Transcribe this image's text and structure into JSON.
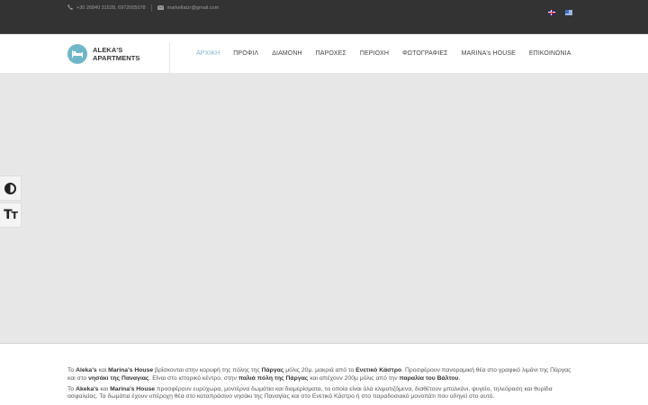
{
  "topbar": {
    "phone_icon": "phone-icon",
    "phone": "+30 26840 31528, 6972005078",
    "email_icon": "envelope-icon",
    "email": "markellatzr@gmail.com",
    "languages": [
      {
        "code": "en",
        "icon": "uk-flag-icon"
      },
      {
        "code": "el",
        "icon": "greek-flag-icon"
      }
    ]
  },
  "logo": {
    "line1": "ALEKA'S",
    "line2": "APARTMENTS",
    "icon": "bed-icon",
    "color": "#6fb6c8"
  },
  "nav": {
    "items": [
      {
        "label": "ΑΡΧΙΚΗ",
        "active": true
      },
      {
        "label": "ΠΡΟΦΙΛ"
      },
      {
        "label": "ΔΙΑΜΟΝΗ"
      },
      {
        "label": "ΠΑΡΟΧΕΣ"
      },
      {
        "label": "ΠΕΡΙΟΧΗ"
      },
      {
        "label": "ΦΩΤΟΓΡΑΦΙΕΣ"
      },
      {
        "label": "MARINA's HOUSE"
      },
      {
        "label": "ΕΠΙΚΟΙΝΩΝΙΑ"
      }
    ],
    "active_color": "#7fb6cf"
  },
  "accessibility": {
    "contrast_icon": "contrast-toggle-icon",
    "fontsize_icon": "font-size-icon"
  },
  "content": {
    "p1": {
      "t1": "Το ",
      "b1": "Aleka's",
      "t2": " και ",
      "b2": "Marina's House",
      "t3": " βρίσκονται στην κορυφή της πόλης της ",
      "b3": "Πάργας",
      "t4": " μόλις 20μ. μακριά από το ",
      "b4": "Ενετικό Κάστρο",
      "t5": ". Προσφέρουν πανοραμική θέα στο γραφικό λιμάνι της Πάργας και στο ",
      "b5": "νησάκι της Παναγιας",
      "t6": ". Είναι στο ιστορικό κέντρο, στην ",
      "b6": "παλιά πόλη της Πάργας",
      "t7": " και απέχουν 200μ μόλις από την ",
      "b7": "παραλία του Βάλτου",
      "t8": "."
    },
    "p2": {
      "t1": "Το ",
      "b1": "Akeka's",
      "t2": " και ",
      "b2": "Marina's House",
      "t3": " προσφέρουν ευρύχωρα, μοντέρνα δωμάτια και διαμερίσματα, τα οποία είναι όλα κλιματιζόμενα, διαθέτουν μπαλκόνι, ψυγείο, τηλεόραση και θυρίδα ασφαλείας. Τα δωμάτια έχουν υπέροχη θέα στο καταπράσινο νησάκι της Παναγίας και στο Ενετικό Κάστρο ή στο παραδοσιακό μονοπάτι που οδηγεί στο αυτό."
    }
  }
}
